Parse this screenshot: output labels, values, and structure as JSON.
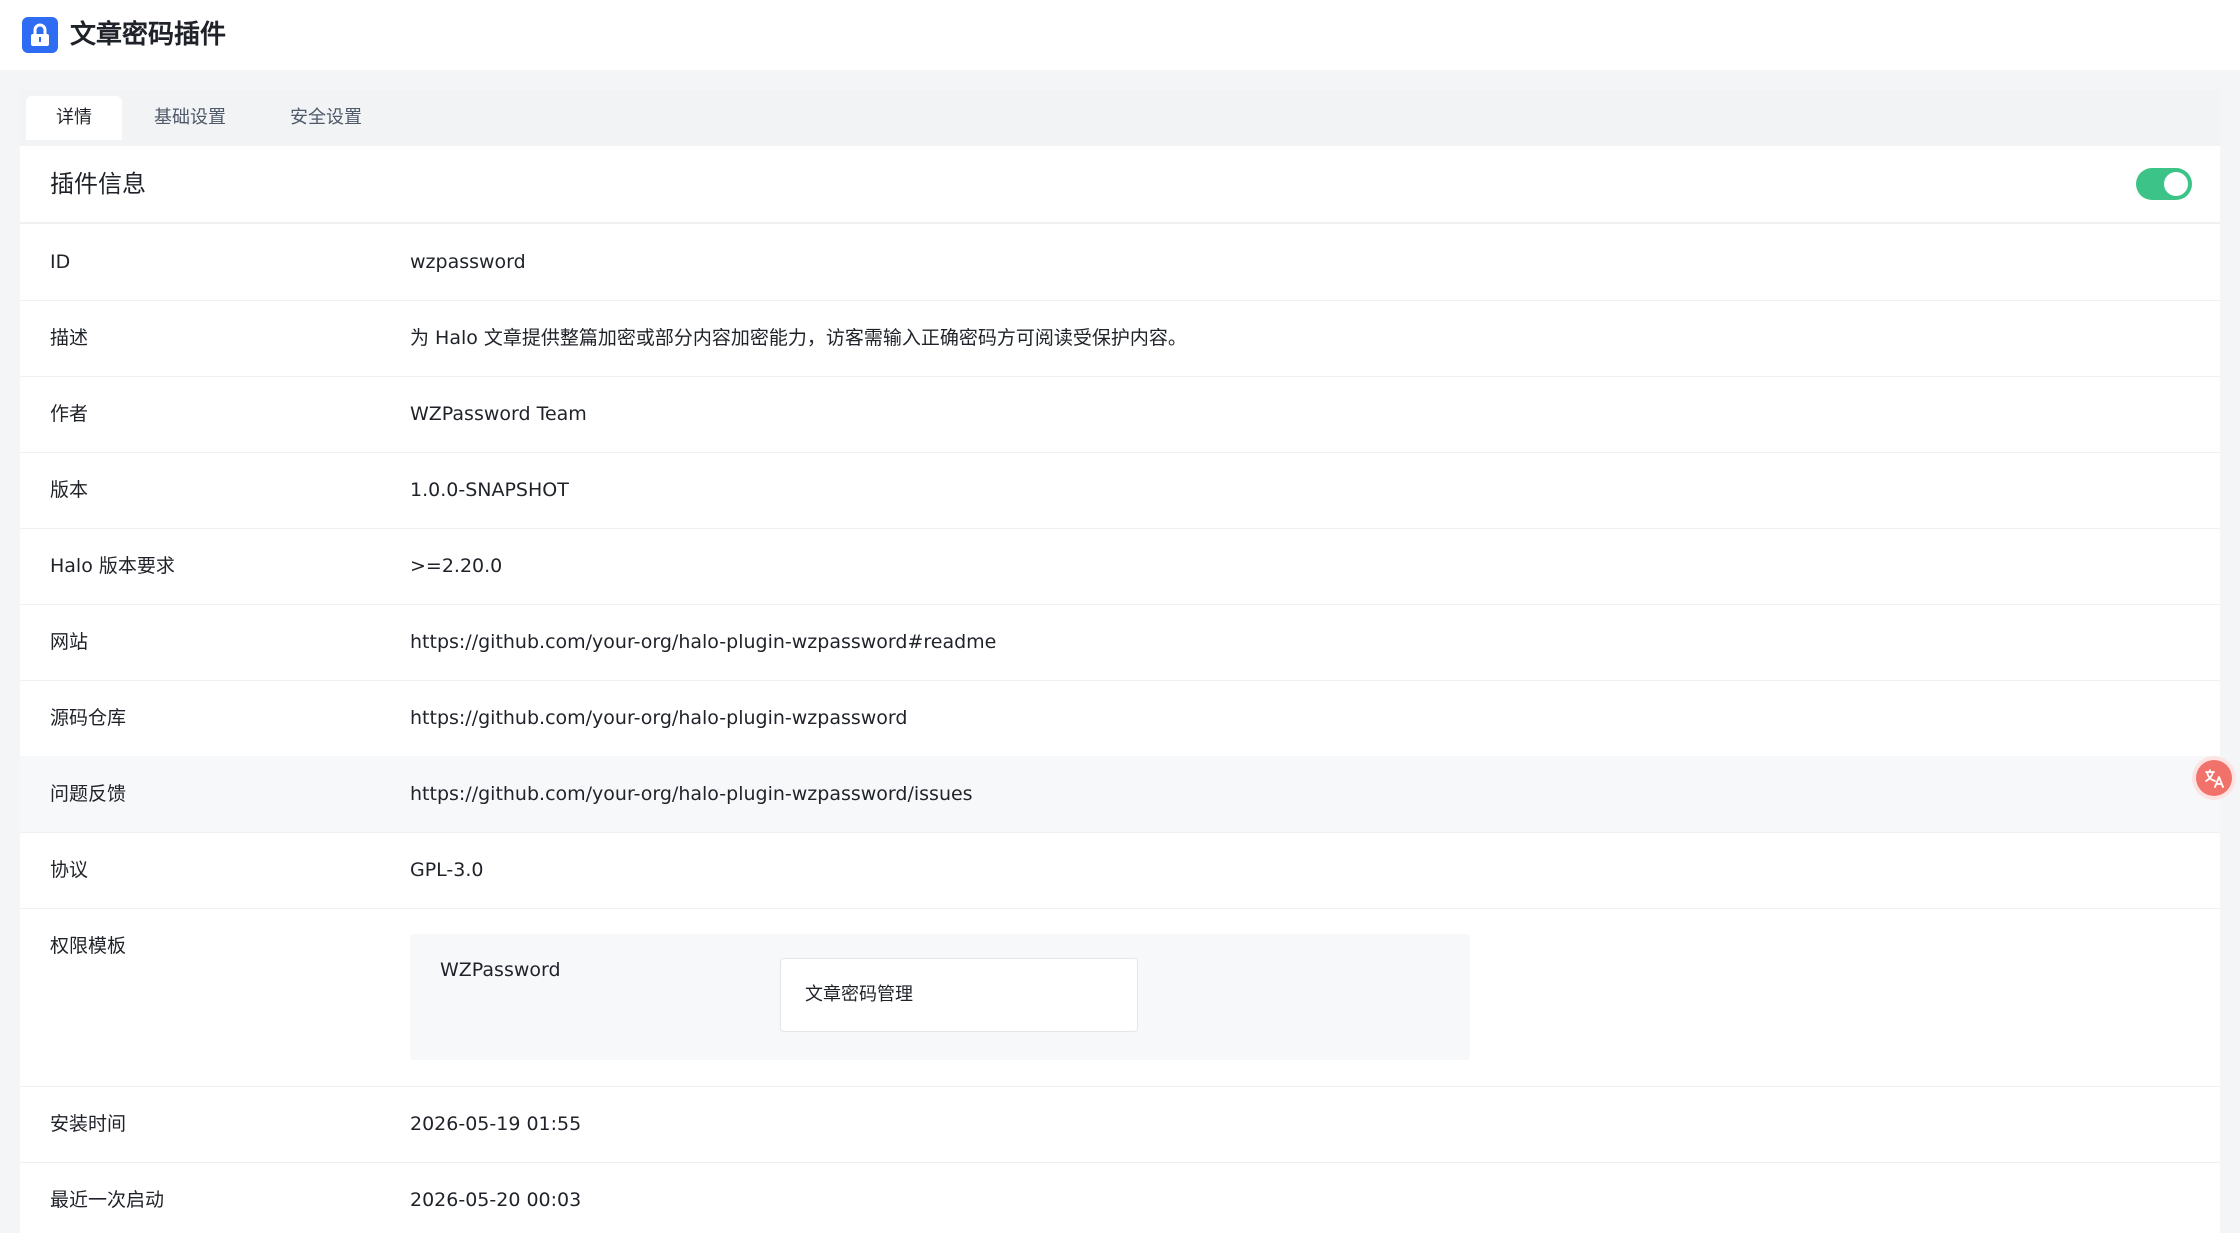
{
  "header": {
    "title": "文章密码插件",
    "logo_icon": "lock-icon"
  },
  "tabs": [
    {
      "label": "详情",
      "active": true
    },
    {
      "label": "基础设置",
      "active": false
    },
    {
      "label": "安全设置",
      "active": false
    }
  ],
  "section": {
    "title": "插件信息",
    "enabled": true
  },
  "rows": [
    {
      "label": "ID",
      "value": "wzpassword"
    },
    {
      "label": "描述",
      "value": "为 Halo 文章提供整篇加密或部分内容加密能力，访客需输入正确密码方可阅读受保护内容。"
    },
    {
      "label": "作者",
      "value": "WZPassword Team"
    },
    {
      "label": "版本",
      "value": "1.0.0-SNAPSHOT"
    },
    {
      "label": "Halo 版本要求",
      "value": ">=2.20.0"
    },
    {
      "label": "网站",
      "value": "https://github.com/your-org/halo-plugin-wzpassword#readme"
    },
    {
      "label": "源码仓库",
      "value": "https://github.com/your-org/halo-plugin-wzpassword"
    },
    {
      "label": "问题反馈",
      "value": "https://github.com/your-org/halo-plugin-wzpassword/issues"
    },
    {
      "label": "协议",
      "value": "GPL-3.0"
    }
  ],
  "permissions": {
    "label": "权限模板",
    "group": "WZPassword",
    "items": [
      "文章密码管理"
    ]
  },
  "install_time": {
    "label": "安装时间",
    "value": "2026-05-19 01:55"
  },
  "last_start": {
    "label": "最近一次启动",
    "value": "2026-05-20 00:03"
  },
  "colors": {
    "accent": "#2d6cf3",
    "toggle_on": "#3cc488",
    "translate": "#f0726a"
  }
}
